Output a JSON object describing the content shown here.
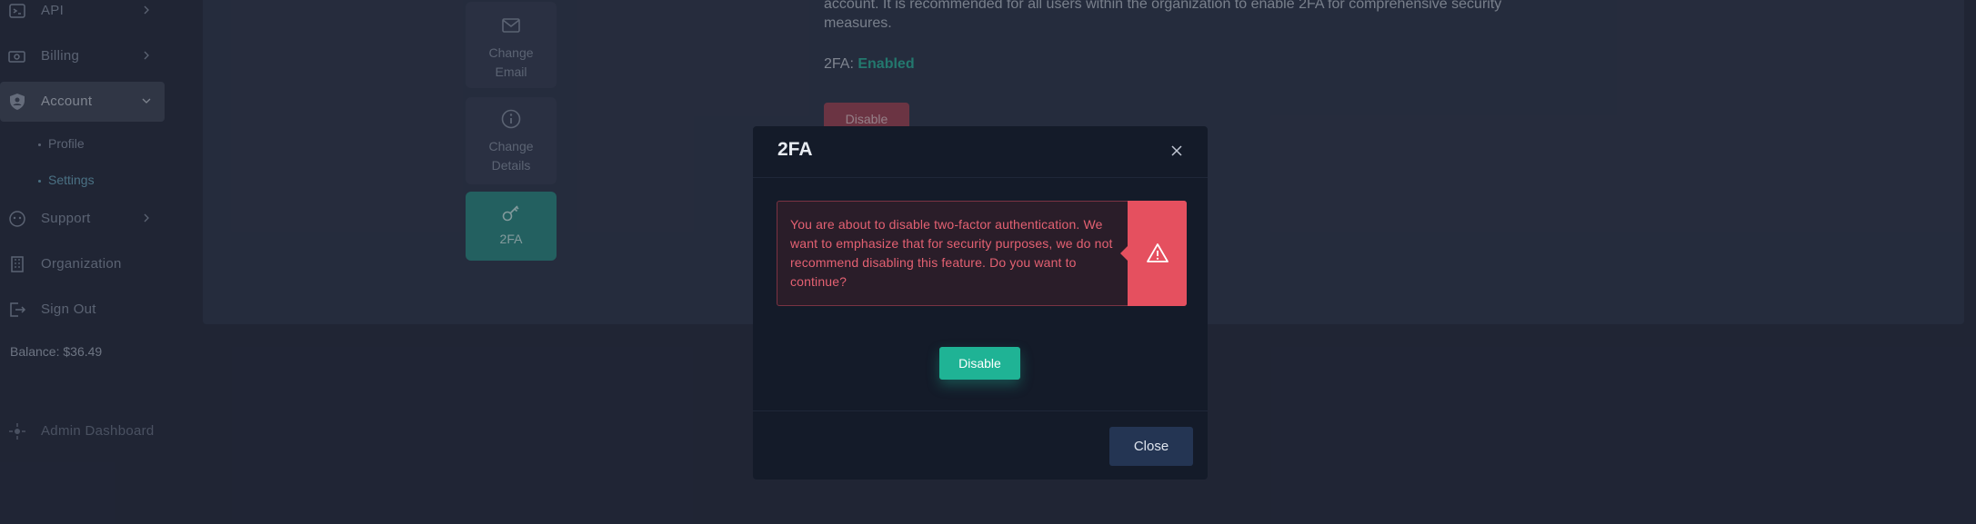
{
  "sidebar": {
    "items": [
      {
        "label": "API",
        "icon": "terminal-icon"
      },
      {
        "label": "Billing",
        "icon": "money-icon"
      },
      {
        "label": "Account",
        "icon": "shield-user-icon"
      },
      {
        "label": "Support",
        "icon": "support-icon"
      },
      {
        "label": "Organization",
        "icon": "building-icon"
      },
      {
        "label": "Sign Out",
        "icon": "sign-out-icon"
      }
    ],
    "sub_items": [
      {
        "label": "Profile"
      },
      {
        "label": "Settings"
      }
    ],
    "balance": "Balance: $36.49",
    "admin_label": "Admin Dashboard"
  },
  "settings_tabs": [
    {
      "line1": "Change",
      "line2": "Email",
      "icon": "mail-icon"
    },
    {
      "line1": "Change",
      "line2": "Details",
      "icon": "info-icon"
    },
    {
      "line1": "2FA",
      "line2": "",
      "icon": "key-icon"
    }
  ],
  "main": {
    "description": "account. It is recommended for all users within the organization to enable 2FA for comprehensive security measures.",
    "status_label": "2FA:",
    "status_value": "Enabled",
    "disable_label": "Disable"
  },
  "modal": {
    "title": "2FA",
    "warning": "You are about to disable two-factor authentication. We want to emphasize that for security purposes, we do not recommend disabling this feature. Do you want to continue?",
    "disable_label": "Disable",
    "close_label": "Close"
  },
  "colors": {
    "accent": "#1fb395",
    "danger": "#e5505f",
    "enabled": "#2fb59e"
  }
}
